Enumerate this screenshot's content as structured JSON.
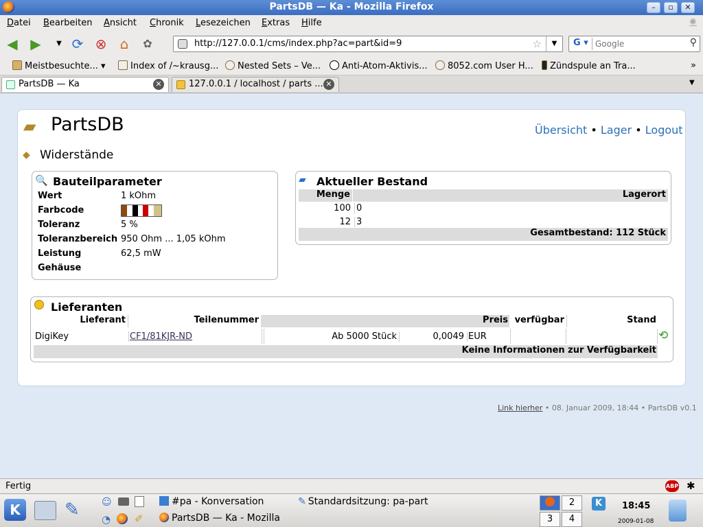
{
  "window": {
    "title": "PartsDB — Ka - Mozilla Firefox"
  },
  "menu": [
    "Datei",
    "Bearbeiten",
    "Ansicht",
    "Chronik",
    "Lesezeichen",
    "Extras",
    "Hilfe"
  ],
  "url": "http://127.0.0.1/cms/index.php?ac=part&id=9",
  "search": {
    "engine": "G",
    "placeholder": "Google"
  },
  "bookmarks": [
    "Meistbesuchte...",
    "Index of /~krausg...",
    "Nested Sets – Ve...",
    "Anti-Atom-Aktivis...",
    "8052.com User H...",
    "Zündspule an Tra..."
  ],
  "tabs": [
    "PartsDB — Ka",
    "127.0.0.1 / localhost / parts ..."
  ],
  "page": {
    "app_title": "PartsDB",
    "nav": [
      "Übersicht",
      "Lager",
      "Logout"
    ],
    "category": "Widerstände",
    "params": {
      "title": "Bauteilparameter",
      "rows": [
        {
          "label": "Wert",
          "value": "1 kOhm"
        },
        {
          "label": "Farbcode",
          "value": ""
        },
        {
          "label": "Toleranz",
          "value": "5 %"
        },
        {
          "label": "Toleranzbereich",
          "value": "950 Ohm ... 1,05 kOhm"
        },
        {
          "label": "Leistung",
          "value": "62,5 mW"
        },
        {
          "label": "Gehäuse",
          "value": ""
        }
      ],
      "color_bands": [
        "#8b4a10",
        "#000000",
        "#cc0000",
        "#ffffff",
        "#d1c386"
      ]
    },
    "stock": {
      "title": "Aktueller Bestand",
      "col_qty": "Menge",
      "col_loc": "Lagerort",
      "rows": [
        {
          "qty": "100",
          "loc": "0"
        },
        {
          "qty": "12",
          "loc": "3"
        }
      ],
      "total": "Gesamtbestand: 112 Stück"
    },
    "suppliers": {
      "title": "Lieferanten",
      "cols": [
        "Lieferant",
        "Teilenummer",
        "Preis",
        "verfügbar",
        "Stand"
      ],
      "row": {
        "supplier": "DigiKey",
        "part_no": "CF1/81KJR-ND",
        "min": "Ab 5000 Stück",
        "price": "0,0049",
        "currency": "EUR"
      },
      "footer": "Keine Informationen zur Verfügbarkeit"
    },
    "footer": {
      "link": "Link hierher",
      "text": " • 08. Januar 2009, 18:44 • PartsDB v0.1"
    }
  },
  "status": "Fertig",
  "taskbar": {
    "tasks": [
      "#pa - Konversation",
      "Standardsitzung: pa-part",
      "PartsDB — Ka - Mozilla"
    ],
    "desktops": [
      "2",
      "3",
      "4"
    ],
    "time": "18:45",
    "date": "2009-01-08"
  }
}
